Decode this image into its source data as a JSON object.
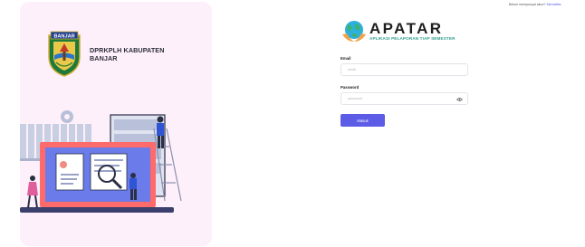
{
  "header": {
    "register_prompt": "Belum mempunyai akun?",
    "register_link": "Mendaftar"
  },
  "sidebar": {
    "crest_label": "BANJAR",
    "org_name": "DPRKPLH KABUPATEN BANJAR"
  },
  "logo": {
    "title": "APATAR",
    "subtitle": "APLIKASI PELAPORAN TIAP SEMESTER"
  },
  "form": {
    "email_label": "Email",
    "email_placeholder": "email",
    "password_label": "Password",
    "password_placeholder": "password",
    "submit_label": "Masuk"
  },
  "colors": {
    "accent": "#5d5ce6",
    "panel_bg": "#fdf0fb",
    "brand_teal": "#2e9d8a"
  },
  "icons": [
    "banjar-crest",
    "apatar-globe-logo",
    "eye-icon"
  ]
}
